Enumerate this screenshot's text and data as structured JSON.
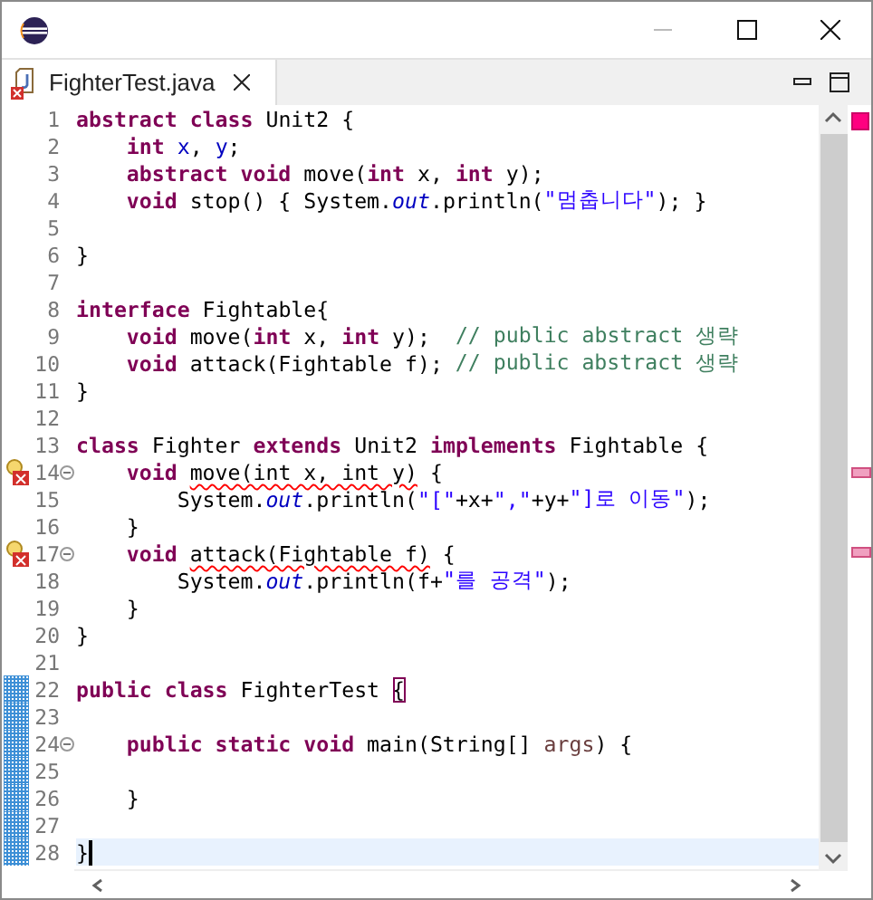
{
  "tab": {
    "label": "FighterTest.java",
    "selected": true,
    "has_error": true
  },
  "lines": [
    {
      "number": "1",
      "tokens": [
        {
          "kind": "keyword",
          "text": "abstract class"
        },
        {
          "kind": "plain",
          "text": " Unit2 {"
        }
      ]
    },
    {
      "number": "2",
      "tokens": [
        {
          "kind": "keyword",
          "text": "    int"
        },
        {
          "kind": "field",
          "text": " x"
        },
        {
          "kind": "plain",
          "text": ", "
        },
        {
          "kind": "field",
          "text": "y"
        },
        {
          "kind": "plain",
          "text": ";"
        }
      ]
    },
    {
      "number": "3",
      "tokens": [
        {
          "kind": "keyword",
          "text": "    abstract void"
        },
        {
          "kind": "plain",
          "text": " move("
        },
        {
          "kind": "keyword",
          "text": "int"
        },
        {
          "kind": "plain",
          "text": " x, "
        },
        {
          "kind": "keyword",
          "text": "int"
        },
        {
          "kind": "plain",
          "text": " y);"
        }
      ]
    },
    {
      "number": "4",
      "tokens": [
        {
          "kind": "keyword",
          "text": "    void"
        },
        {
          "kind": "plain",
          "text": " stop() { System."
        },
        {
          "kind": "static",
          "text": "out"
        },
        {
          "kind": "plain",
          "text": ".println("
        },
        {
          "kind": "string",
          "text": "\"멈춥니다\""
        },
        {
          "kind": "plain",
          "text": "); }"
        }
      ]
    },
    {
      "number": "5"
    },
    {
      "number": "6",
      "tokens": [
        {
          "kind": "plain",
          "text": "}"
        }
      ]
    },
    {
      "number": "7"
    },
    {
      "number": "8",
      "tokens": [
        {
          "kind": "keyword",
          "text": "interface"
        },
        {
          "kind": "plain",
          "text": " Fightable{"
        }
      ]
    },
    {
      "number": "9",
      "tokens": [
        {
          "kind": "keyword",
          "text": "    void"
        },
        {
          "kind": "plain",
          "text": " move("
        },
        {
          "kind": "keyword",
          "text": "int"
        },
        {
          "kind": "plain",
          "text": " x, "
        },
        {
          "kind": "keyword",
          "text": "int"
        },
        {
          "kind": "plain",
          "text": " y);  "
        },
        {
          "kind": "comment",
          "text": "// public abstract 생략"
        }
      ]
    },
    {
      "number": "10",
      "tokens": [
        {
          "kind": "keyword",
          "text": "    void"
        },
        {
          "kind": "plain",
          "text": " attack(Fightable f); "
        },
        {
          "kind": "comment",
          "text": "// public abstract 생략"
        }
      ]
    },
    {
      "number": "11",
      "tokens": [
        {
          "kind": "plain",
          "text": "}"
        }
      ]
    },
    {
      "number": "12"
    },
    {
      "number": "13",
      "tokens": [
        {
          "kind": "keyword",
          "text": "class"
        },
        {
          "kind": "plain",
          "text": " Fighter "
        },
        {
          "kind": "keyword",
          "text": "extends"
        },
        {
          "kind": "plain",
          "text": " Unit2 "
        },
        {
          "kind": "keyword",
          "text": "implements"
        },
        {
          "kind": "plain",
          "text": " Fightable {"
        }
      ]
    },
    {
      "number": "14",
      "error": true,
      "foldable": true,
      "tokens": [
        {
          "kind": "keyword",
          "text": "    void "
        },
        {
          "kind": "squiggle",
          "text": "move(int x, int y)"
        },
        {
          "kind": "plain",
          "text": " {"
        }
      ]
    },
    {
      "number": "15",
      "tokens": [
        {
          "kind": "plain",
          "text": "        System."
        },
        {
          "kind": "static",
          "text": "out"
        },
        {
          "kind": "plain",
          "text": ".println("
        },
        {
          "kind": "string",
          "text": "\"[\""
        },
        {
          "kind": "plain",
          "text": "+x+"
        },
        {
          "kind": "string",
          "text": "\",\""
        },
        {
          "kind": "plain",
          "text": "+y+"
        },
        {
          "kind": "string",
          "text": "\"]로 이동\""
        },
        {
          "kind": "plain",
          "text": ");"
        }
      ]
    },
    {
      "number": "16",
      "tokens": [
        {
          "kind": "plain",
          "text": "    }"
        }
      ]
    },
    {
      "number": "17",
      "error": true,
      "foldable": true,
      "tokens": [
        {
          "kind": "keyword",
          "text": "    void "
        },
        {
          "kind": "squiggle",
          "text": "attack(Fightable f)"
        },
        {
          "kind": "plain",
          "text": " {"
        }
      ]
    },
    {
      "number": "18",
      "tokens": [
        {
          "kind": "plain",
          "text": "        System."
        },
        {
          "kind": "static",
          "text": "out"
        },
        {
          "kind": "plain",
          "text": ".println(f+"
        },
        {
          "kind": "string",
          "text": "\"를 공격\""
        },
        {
          "kind": "plain",
          "text": ");"
        }
      ]
    },
    {
      "number": "19",
      "tokens": [
        {
          "kind": "plain",
          "text": "    }"
        }
      ]
    },
    {
      "number": "20",
      "tokens": [
        {
          "kind": "plain",
          "text": "}"
        }
      ]
    },
    {
      "number": "21"
    },
    {
      "number": "22",
      "changed": true,
      "tokens": [
        {
          "kind": "keyword",
          "text": "public class"
        },
        {
          "kind": "plain",
          "text": " FighterTest "
        },
        {
          "kind": "bracket",
          "text": "{"
        }
      ]
    },
    {
      "number": "23",
      "changed": true
    },
    {
      "number": "24",
      "changed": true,
      "foldable": true,
      "tokens": [
        {
          "kind": "keyword",
          "text": "    public static void"
        },
        {
          "kind": "plain",
          "text": " main(String[] "
        },
        {
          "kind": "param",
          "text": "args"
        },
        {
          "kind": "plain",
          "text": ") {"
        }
      ]
    },
    {
      "number": "25",
      "changed": true
    },
    {
      "number": "26",
      "changed": true,
      "tokens": [
        {
          "kind": "plain",
          "text": "    }"
        }
      ]
    },
    {
      "number": "27",
      "changed": true
    },
    {
      "number": "28",
      "changed": true,
      "current": true,
      "tokens": [
        {
          "kind": "plain",
          "text": "}"
        }
      ]
    }
  ]
}
